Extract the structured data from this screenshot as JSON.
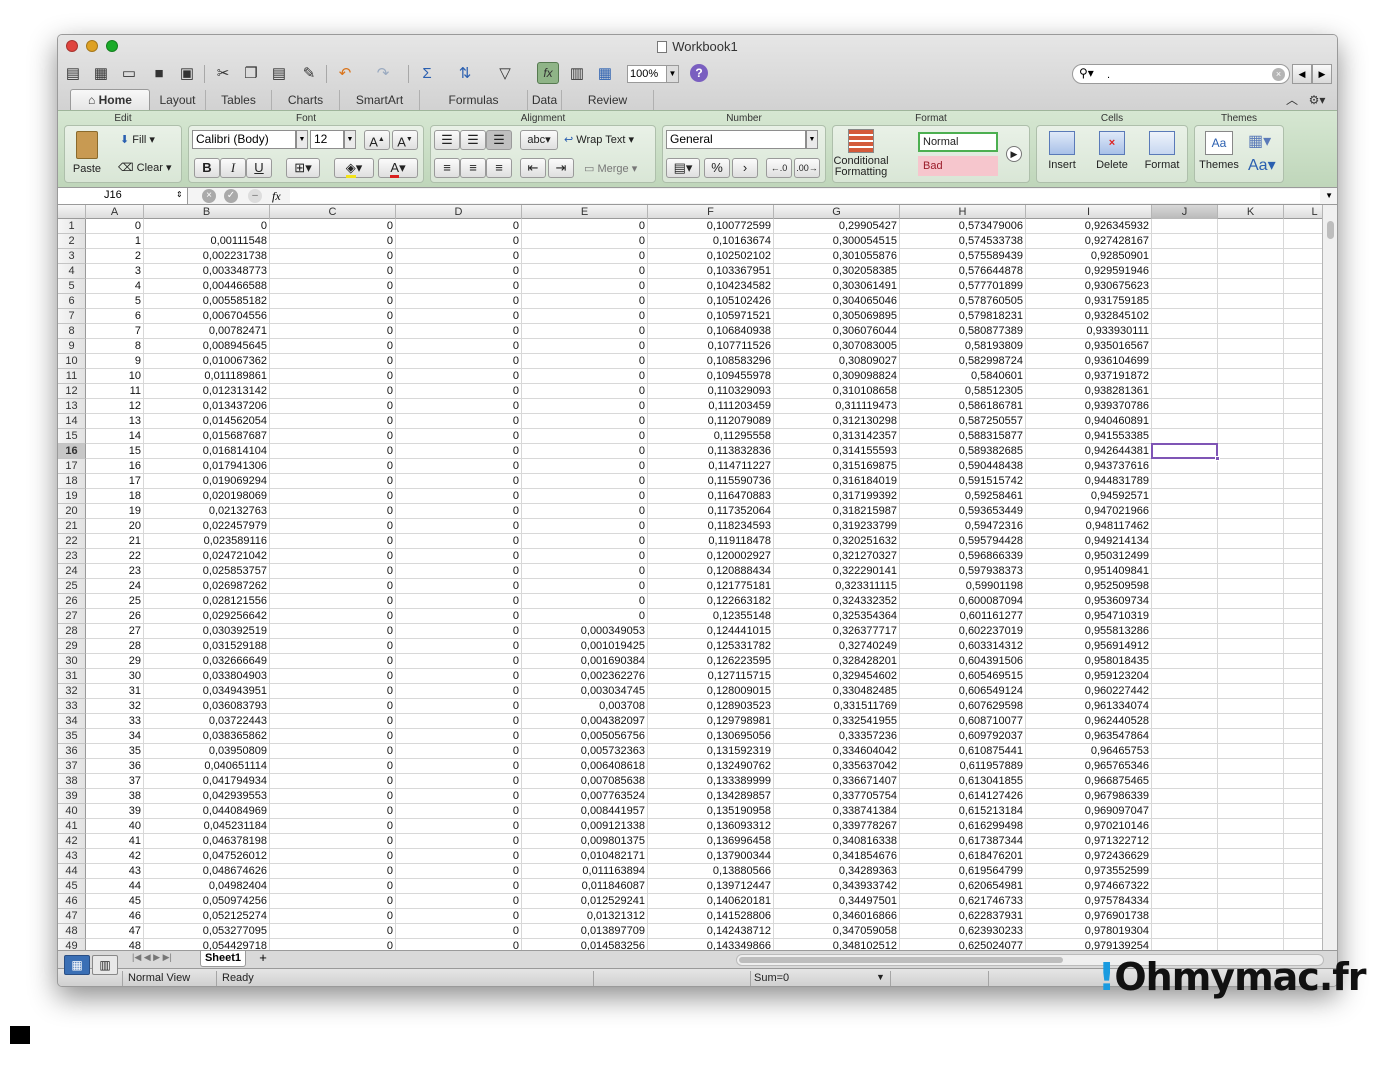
{
  "window": {
    "title": "Workbook1"
  },
  "colors": {
    "close": "#e0443e",
    "minimize": "#dea123",
    "zoom": "#1aab29",
    "ribbon": "#cfe1cb",
    "active_cell_border": "#7f55b5"
  },
  "toolbar": {
    "icons": [
      "new-workbook-icon",
      "templates-icon",
      "open-icon",
      "save-icon",
      "print-icon",
      "cut-icon",
      "copy-icon",
      "paste-icon",
      "format-painter-icon",
      "undo-icon",
      "redo-icon",
      "autosum-icon",
      "sort-icon",
      "filter-icon",
      "formula-builder-icon",
      "gallery-icon",
      "media-browser-icon",
      "help-icon"
    ],
    "zoom": "100%",
    "search_value": "."
  },
  "tabs": [
    "Home",
    "Layout",
    "Tables",
    "Charts",
    "SmartArt",
    "Formulas",
    "Data",
    "Review"
  ],
  "ribbon": {
    "groups": {
      "edit": "Edit",
      "font": "Font",
      "alignment": "Alignment",
      "number": "Number",
      "format": "Format",
      "cells": "Cells",
      "themes": "Themes"
    },
    "paste": "Paste",
    "fill": "Fill",
    "clear": "Clear",
    "font_name": "Calibri (Body)",
    "font_size": "12",
    "wrap_text": "Wrap Text",
    "merge": "Merge",
    "abc": "abc",
    "number_format": "General",
    "conditional_formatting": "Conditional Formatting",
    "style_normal": "Normal",
    "style_bad": "Bad",
    "insert": "Insert",
    "delete": "Delete",
    "format_btn": "Format",
    "themes_btn": "Themes",
    "bold": "B",
    "italic": "I",
    "underline": "U",
    "percent": "%",
    "comma": "›",
    "font_color": "A",
    "aa": "Aa"
  },
  "formula_bar": {
    "name_box": "J16",
    "fx": "fx"
  },
  "grid": {
    "columns": [
      "A",
      "B",
      "C",
      "D",
      "E",
      "F",
      "G",
      "H",
      "I",
      "J",
      "K",
      "L"
    ],
    "selected_column": "J",
    "selected_row": 16,
    "rows": [
      [
        "0",
        "0",
        "0",
        "0",
        "0",
        "0,100772599",
        "0,29905427",
        "0,573479006",
        "0,926345932"
      ],
      [
        "1",
        "0,00111548",
        "0",
        "0",
        "0",
        "0,10163674",
        "0,300054515",
        "0,574533738",
        "0,927428167"
      ],
      [
        "2",
        "0,002231738",
        "0",
        "0",
        "0",
        "0,102502102",
        "0,301055876",
        "0,575589439",
        "0,92850901"
      ],
      [
        "3",
        "0,003348773",
        "0",
        "0",
        "0",
        "0,103367951",
        "0,302058385",
        "0,576644878",
        "0,929591946"
      ],
      [
        "4",
        "0,004466588",
        "0",
        "0",
        "0",
        "0,104234582",
        "0,303061491",
        "0,577701899",
        "0,930675623"
      ],
      [
        "5",
        "0,005585182",
        "0",
        "0",
        "0",
        "0,105102426",
        "0,304065046",
        "0,578760505",
        "0,931759185"
      ],
      [
        "6",
        "0,006704556",
        "0",
        "0",
        "0",
        "0,105971521",
        "0,305069895",
        "0,579818231",
        "0,932845102"
      ],
      [
        "7",
        "0,00782471",
        "0",
        "0",
        "0",
        "0,106840938",
        "0,306076044",
        "0,580877389",
        "0,933930111"
      ],
      [
        "8",
        "0,008945645",
        "0",
        "0",
        "0",
        "0,107711526",
        "0,307083005",
        "0,58193809",
        "0,935016567"
      ],
      [
        "9",
        "0,010067362",
        "0",
        "0",
        "0",
        "0,108583296",
        "0,30809027",
        "0,582998724",
        "0,936104699"
      ],
      [
        "10",
        "0,011189861",
        "0",
        "0",
        "0",
        "0,109455978",
        "0,309098824",
        "0,5840601",
        "0,937191872"
      ],
      [
        "11",
        "0,012313142",
        "0",
        "0",
        "0",
        "0,110329093",
        "0,310108658",
        "0,58512305",
        "0,938281361"
      ],
      [
        "12",
        "0,013437206",
        "0",
        "0",
        "0",
        "0,111203459",
        "0,311119473",
        "0,586186781",
        "0,939370786"
      ],
      [
        "13",
        "0,014562054",
        "0",
        "0",
        "0",
        "0,112079089",
        "0,312130298",
        "0,587250557",
        "0,940460891"
      ],
      [
        "14",
        "0,015687687",
        "0",
        "0",
        "0",
        "0,11295558",
        "0,313142357",
        "0,588315877",
        "0,941553385"
      ],
      [
        "15",
        "0,016814104",
        "0",
        "0",
        "0",
        "0,113832836",
        "0,314155593",
        "0,589382685",
        "0,942644381"
      ],
      [
        "16",
        "0,017941306",
        "0",
        "0",
        "0",
        "0,114711227",
        "0,315169875",
        "0,590448438",
        "0,943737616"
      ],
      [
        "17",
        "0,019069294",
        "0",
        "0",
        "0",
        "0,115590736",
        "0,316184019",
        "0,591515742",
        "0,944831789"
      ],
      [
        "18",
        "0,020198069",
        "0",
        "0",
        "0",
        "0,116470883",
        "0,317199392",
        "0,59258461",
        "0,94592571"
      ],
      [
        "19",
        "0,02132763",
        "0",
        "0",
        "0",
        "0,117352064",
        "0,318215987",
        "0,593653449",
        "0,947021966"
      ],
      [
        "20",
        "0,022457979",
        "0",
        "0",
        "0",
        "0,118234593",
        "0,319233799",
        "0,59472316",
        "0,948117462"
      ],
      [
        "21",
        "0,023589116",
        "0",
        "0",
        "0",
        "0,119118478",
        "0,320251632",
        "0,595794428",
        "0,949214134"
      ],
      [
        "22",
        "0,024721042",
        "0",
        "0",
        "0",
        "0,120002927",
        "0,321270327",
        "0,596866339",
        "0,950312499"
      ],
      [
        "23",
        "0,025853757",
        "0",
        "0",
        "0",
        "0,120888434",
        "0,322290141",
        "0,597938373",
        "0,951409841"
      ],
      [
        "24",
        "0,026987262",
        "0",
        "0",
        "0",
        "0,121775181",
        "0,323311115",
        "0,59901198",
        "0,952509598"
      ],
      [
        "25",
        "0,028121556",
        "0",
        "0",
        "0",
        "0,122663182",
        "0,324332352",
        "0,600087094",
        "0,953609734"
      ],
      [
        "26",
        "0,029256642",
        "0",
        "0",
        "0",
        "0,12355148",
        "0,325354364",
        "0,601161277",
        "0,954710319"
      ],
      [
        "27",
        "0,030392519",
        "0",
        "0",
        "0,000349053",
        "0,124441015",
        "0,326377717",
        "0,602237019",
        "0,955813286"
      ],
      [
        "28",
        "0,031529188",
        "0",
        "0",
        "0,001019425",
        "0,125331782",
        "0,32740249",
        "0,603314312",
        "0,956914912"
      ],
      [
        "29",
        "0,032666649",
        "0",
        "0",
        "0,001690384",
        "0,126223595",
        "0,328428201",
        "0,604391506",
        "0,958018435"
      ],
      [
        "30",
        "0,033804903",
        "0",
        "0",
        "0,002362276",
        "0,127115715",
        "0,329454602",
        "0,605469515",
        "0,959123204"
      ],
      [
        "31",
        "0,034943951",
        "0",
        "0",
        "0,003034745",
        "0,128009015",
        "0,330482485",
        "0,606549124",
        "0,960227442"
      ],
      [
        "32",
        "0,036083793",
        "0",
        "0",
        "0,003708",
        "0,128903523",
        "0,331511769",
        "0,607629598",
        "0,961334074"
      ],
      [
        "33",
        "0,03722443",
        "0",
        "0",
        "0,004382097",
        "0,129798981",
        "0,332541955",
        "0,608710077",
        "0,962440528"
      ],
      [
        "34",
        "0,038365862",
        "0",
        "0",
        "0,005056756",
        "0,130695056",
        "0,33357236",
        "0,609792037",
        "0,963547864"
      ],
      [
        "35",
        "0,03950809",
        "0",
        "0",
        "0,005732363",
        "0,131592319",
        "0,334604042",
        "0,610875441",
        "0,96465753"
      ],
      [
        "36",
        "0,040651114",
        "0",
        "0",
        "0,006408618",
        "0,132490762",
        "0,335637042",
        "0,611957889",
        "0,965765346"
      ],
      [
        "37",
        "0,041794934",
        "0",
        "0",
        "0,007085638",
        "0,133389999",
        "0,336671407",
        "0,613041855",
        "0,966875465"
      ],
      [
        "38",
        "0,042939553",
        "0",
        "0",
        "0,007763524",
        "0,134289857",
        "0,337705754",
        "0,614127426",
        "0,967986339"
      ],
      [
        "39",
        "0,044084969",
        "0",
        "0",
        "0,008441957",
        "0,135190958",
        "0,338741384",
        "0,615213184",
        "0,969097047"
      ],
      [
        "40",
        "0,045231184",
        "0",
        "0",
        "0,009121338",
        "0,136093312",
        "0,339778267",
        "0,616299498",
        "0,970210146"
      ],
      [
        "41",
        "0,046378198",
        "0",
        "0",
        "0,009801375",
        "0,136996458",
        "0,340816338",
        "0,617387344",
        "0,971322712"
      ],
      [
        "42",
        "0,047526012",
        "0",
        "0",
        "0,010482171",
        "0,137900344",
        "0,341854676",
        "0,618476201",
        "0,972436629"
      ],
      [
        "43",
        "0,048674626",
        "0",
        "0",
        "0,011163894",
        "0,13880566",
        "0,34289363",
        "0,619564799",
        "0,973552599"
      ],
      [
        "44",
        "0,04982404",
        "0",
        "0",
        "0,011846087",
        "0,139712447",
        "0,343933742",
        "0,620654981",
        "0,974667322"
      ],
      [
        "45",
        "0,050974256",
        "0",
        "0",
        "0,012529241",
        "0,140620181",
        "0,34497501",
        "0,621746733",
        "0,975784334"
      ],
      [
        "46",
        "0,052125274",
        "0",
        "0",
        "0,01321312",
        "0,141528806",
        "0,346016866",
        "0,622837931",
        "0,976901738"
      ],
      [
        "47",
        "0,053277095",
        "0",
        "0",
        "0,013897709",
        "0,142438712",
        "0,347059058",
        "0,623930233",
        "0,978019304"
      ],
      [
        "48",
        "0,054429718",
        "0",
        "0",
        "0,014583256",
        "0,143349866",
        "0,348102512",
        "0,625024077",
        "0,979139254"
      ]
    ]
  },
  "sheets": [
    "Sheet1"
  ],
  "status": {
    "view": "Normal View",
    "state": "Ready",
    "sum": "Sum=0"
  },
  "watermark": {
    "bang": "!",
    "text": "Ohmymac.fr"
  }
}
